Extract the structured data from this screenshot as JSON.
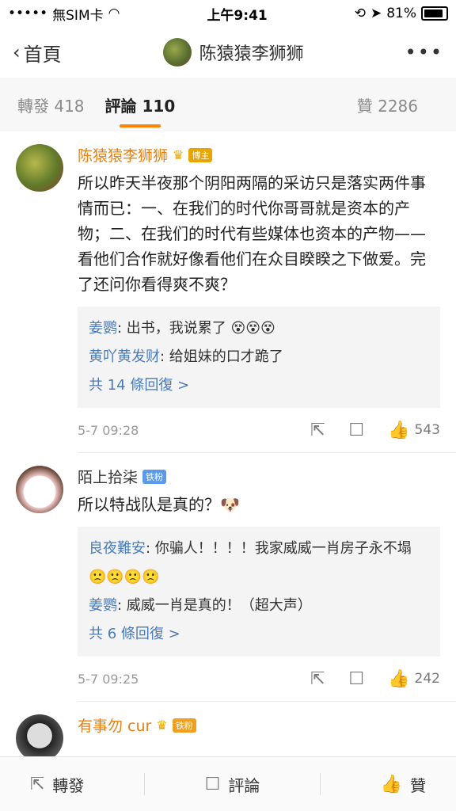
{
  "status": {
    "carrier": "無SIM卡",
    "time": "上午9:41",
    "battery": "81%"
  },
  "nav": {
    "back_label": "首頁",
    "title": "陈猿猿李狮狮",
    "more": "•••"
  },
  "tabs": {
    "repost": "轉發 418",
    "comments": "評論 110",
    "likes": "贊 2286"
  },
  "comments": [
    {
      "name": "陈猿猿李狮狮",
      "badge": "博主",
      "text": "所以昨天半夜那个阴阳两隔的采访只是落实两件事情而已：一、在我们的时代你哥哥就是资本的产物；二、在我们的时代有些媒体也资本的产物——看他们合作就好像看他们在众目睽睽之下做爱。完了还问你看得爽不爽？",
      "replies": [
        {
          "name": "姜鹦",
          "text": "出书，我说累了 😵😵😵"
        },
        {
          "name": "黄吖黄发财",
          "text": "给姐妹的口才跪了"
        }
      ],
      "more": "共 14 條回復 >",
      "time": "5-7 09:28",
      "likes": "543"
    },
    {
      "name": "陌上拾柒",
      "badge": "铁粉",
      "text": "所以特战队是真的？🐶",
      "replies": [
        {
          "name": "良夜難安",
          "text": "你骗人！！！！我家威威一肖房子永不塌 🙁🙁🙁🙁"
        },
        {
          "name": "姜鹦",
          "text": "威威一肖是真的！（超大声）"
        }
      ],
      "more": "共 6 條回復 >",
      "time": "5-7 09:25",
      "likes": "242"
    },
    {
      "name": "有事勿 cur",
      "badge": "铁粉"
    }
  ],
  "bottom": {
    "repost": "轉發",
    "comment": "評論",
    "like": "贊"
  }
}
